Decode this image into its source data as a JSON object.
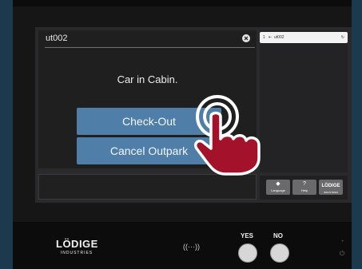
{
  "search": {
    "value": "ut002"
  },
  "dialog": {
    "message": "Car in Cabin.",
    "checkout_label": "Check-Out",
    "cancel_label": "Cancel Outpark"
  },
  "side_list": {
    "items": [
      {
        "index": "1",
        "arrow": "⇤",
        "code": "ut002",
        "refresh": "↻"
      }
    ]
  },
  "side_footer": {
    "language_label": "Language",
    "help_label": "Help",
    "logo_label": "LÖDIGE",
    "logo_sub": "INDUSTRIES"
  },
  "panel": {
    "logo_main": "LÖDIGE",
    "logo_sub": "INDUSTRIES",
    "nfc": "((···))",
    "yes_label": "YES",
    "no_label": "NO",
    "led": "+",
    "power": "⏻"
  },
  "colors": {
    "page_bg": "#1c3a4e",
    "button": "#4f7fa8",
    "pointer": "#a3122a"
  },
  "icons": [
    "clear-icon",
    "refresh-icon",
    "language-icon",
    "help-icon",
    "nfc-icon",
    "power-icon",
    "hand-pointer-icon"
  ]
}
